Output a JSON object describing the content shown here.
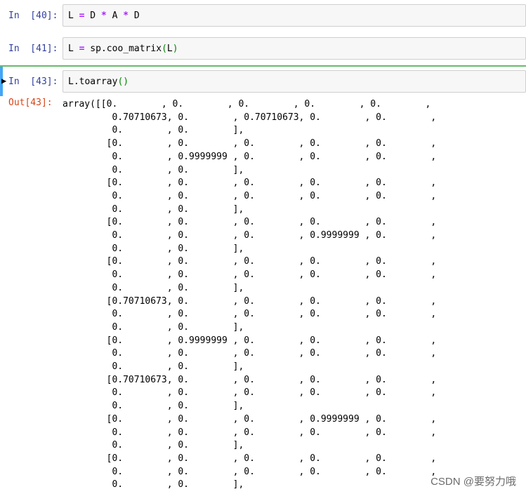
{
  "cells": [
    {
      "prompt": "In  [40]:",
      "code_parts": [
        "L ",
        "=",
        " D ",
        "*",
        " A ",
        "*",
        " D"
      ]
    },
    {
      "prompt": "In  [41]:",
      "code_parts": [
        "L ",
        "=",
        " sp.coo_matrix",
        "(",
        "L",
        ")"
      ]
    },
    {
      "prompt": "In  [43]:",
      "code_parts": [
        "L.toarray",
        "()"
      ]
    }
  ],
  "output": {
    "prompt": "Out[43]:",
    "text": "array([[0.        , 0.        , 0.        , 0.        , 0.        ,\n         0.70710673, 0.        , 0.70710673, 0.        , 0.        ,\n         0.        , 0.        ],\n        [0.        , 0.        , 0.        , 0.        , 0.        ,\n         0.        , 0.9999999 , 0.        , 0.        , 0.        ,\n         0.        , 0.        ],\n        [0.        , 0.        , 0.        , 0.        , 0.        ,\n         0.        , 0.        , 0.        , 0.        , 0.        ,\n         0.        , 0.        ],\n        [0.        , 0.        , 0.        , 0.        , 0.        ,\n         0.        , 0.        , 0.        , 0.9999999 , 0.        ,\n         0.        , 0.        ],\n        [0.        , 0.        , 0.        , 0.        , 0.        ,\n         0.        , 0.        , 0.        , 0.        , 0.        ,\n         0.        , 0.        ],\n        [0.70710673, 0.        , 0.        , 0.        , 0.        ,\n         0.        , 0.        , 0.        , 0.        , 0.        ,\n         0.        , 0.        ],\n        [0.        , 0.9999999 , 0.        , 0.        , 0.        ,\n         0.        , 0.        , 0.        , 0.        , 0.        ,\n         0.        , 0.        ],\n        [0.70710673, 0.        , 0.        , 0.        , 0.        ,\n         0.        , 0.        , 0.        , 0.        , 0.        ,\n         0.        , 0.        ],\n        [0.        , 0.        , 0.        , 0.9999999 , 0.        ,\n         0.        , 0.        , 0.        , 0.        , 0.        ,\n         0.        , 0.        ],\n        [0.        , 0.        , 0.        , 0.        , 0.        ,\n         0.        , 0.        , 0.        , 0.        , 0.        ,\n         0.        , 0.        ],"
  },
  "watermark": "CSDN @要努力哦",
  "colors": {
    "prompt_in": "#303F9F",
    "prompt_out": "#D84315",
    "operator": "#AA22FF",
    "paren": "#008800",
    "selected_border": "#66bb6a"
  }
}
